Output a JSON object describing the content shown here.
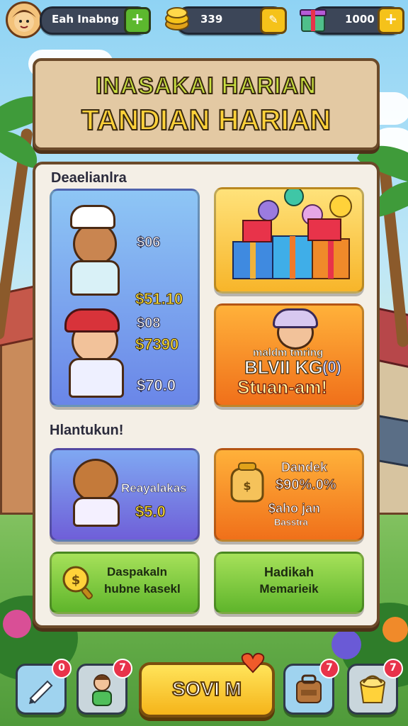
{
  "topbar": {
    "player_name": "Eah Inabng",
    "coins": "339",
    "gems": "1000"
  },
  "title": {
    "line1": "INASAKAI HARIAN",
    "line2": "TANDIAN HARIAN"
  },
  "section1": {
    "label": "Deaelianlra",
    "card1": {
      "price_top": "$06",
      "price_bottom": "$51.10"
    },
    "card2": {
      "price_a": "$08",
      "price_b": "$7390",
      "price_c": "$70.0"
    },
    "card3": {
      "text_small": "maldm tmring",
      "text_big": "BLVII KG",
      "text_mark": "(0)",
      "text_cta": "Stuan-am!"
    }
  },
  "section2": {
    "label": "Hlantukun!",
    "card1": {
      "name": "Reayalakas",
      "price": "$5.0"
    },
    "card2": {
      "title": "Dandek",
      "value": "$90%.0%",
      "sub1": "$aho jan",
      "sub2": "Basstra"
    },
    "card3": {
      "line1": "Daspakaln",
      "line2": "hubne kasekl"
    },
    "card4": {
      "line1": "Hadikah",
      "line2": "Memarieik"
    }
  },
  "bottombar": {
    "main_button": "SOVI M",
    "badges": [
      "0",
      "7",
      "7",
      "7"
    ]
  },
  "colors": {
    "board": "#e3c9a3",
    "panel": "#f4efe6",
    "accent_green": "#5fb52b",
    "accent_gold": "#f5b41a"
  }
}
